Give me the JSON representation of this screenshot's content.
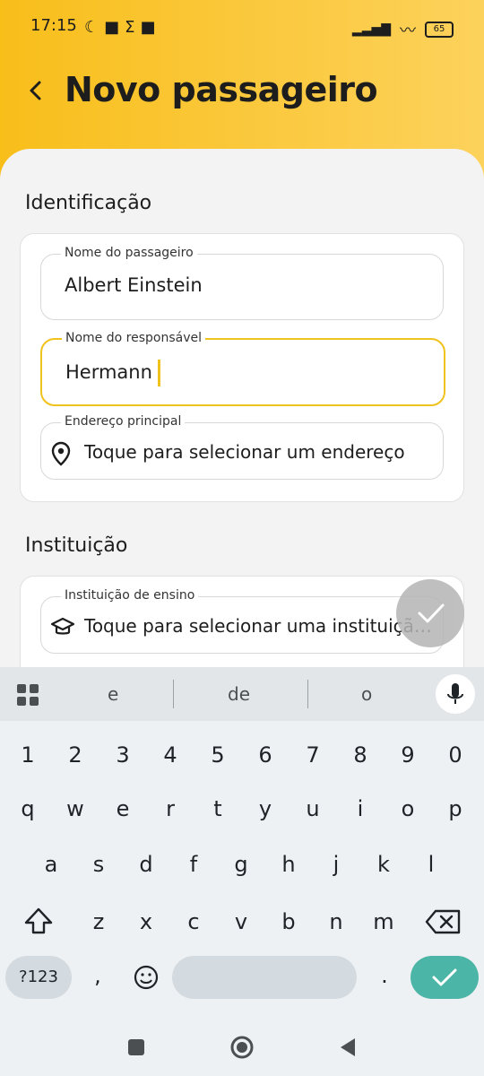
{
  "status_bar": {
    "time": "17:15",
    "battery": "65"
  },
  "header": {
    "title": "Novo passageiro"
  },
  "identificacao": {
    "section_title": "Identificação",
    "nome_passageiro_label": "Nome do passageiro",
    "nome_passageiro_value": "Albert Einstein",
    "nome_responsavel_label": "Nome do responsável",
    "nome_responsavel_value": "Hermann",
    "endereco_label": "Endereço principal",
    "endereco_placeholder": "Toque para selecionar um endereço"
  },
  "instituicao": {
    "section_title": "Instituição",
    "label": "Instituição de ensino",
    "placeholder": "Toque para selecionar uma instituição de ensino"
  },
  "keyboard": {
    "suggestions": [
      "e",
      "de",
      "o"
    ],
    "row_numbers": [
      "1",
      "2",
      "3",
      "4",
      "5",
      "6",
      "7",
      "8",
      "9",
      "0"
    ],
    "row_1": [
      "q",
      "w",
      "e",
      "r",
      "t",
      "y",
      "u",
      "i",
      "o",
      "p"
    ],
    "row_2": [
      "a",
      "s",
      "d",
      "f",
      "g",
      "h",
      "j",
      "k",
      "l"
    ],
    "row_3": [
      "z",
      "x",
      "c",
      "v",
      "b",
      "n",
      "m"
    ],
    "symbols_label": "?123",
    "comma": ",",
    "period": "."
  },
  "colors": {
    "accent": "#f8be1a",
    "focus_border": "#f0c21d",
    "enter_key": "#4bb5a7"
  }
}
